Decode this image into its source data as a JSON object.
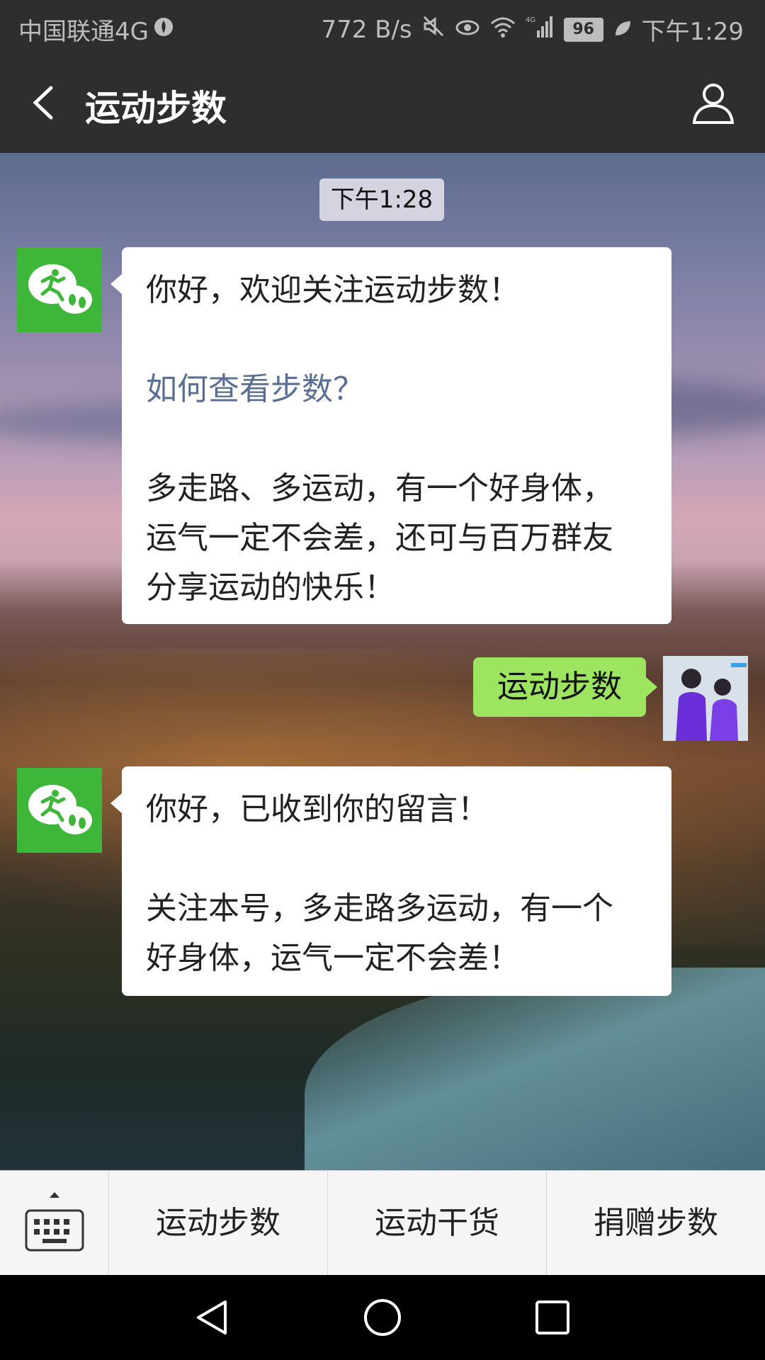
{
  "status_bar": {
    "carrier": "中国联通4G",
    "speed": "772 B/s",
    "battery": "96",
    "time": "下午1:29",
    "network": "4G"
  },
  "header": {
    "title": "运动步数"
  },
  "chat": {
    "timestamp": "下午1:28",
    "messages": [
      {
        "from": "bot",
        "lines": [
          "你好，欢迎关注运动步数！",
          "如何查看步数？",
          "多走路、多运动，有一个好身体，",
          "运气一定不会差，还可与百万群友",
          "分享运动的快乐！"
        ]
      },
      {
        "from": "me",
        "text": "运动步数"
      },
      {
        "from": "bot",
        "lines": [
          "你好，已收到你的留言！",
          "关注本号，多走路多运动，有一个",
          "好身体，运气一定不会差！"
        ]
      }
    ]
  },
  "menu": {
    "items": [
      "运动步数",
      "运动干货",
      "捐赠步数"
    ]
  },
  "colors": {
    "bar_bg": "#2e2e2e",
    "bot_avatar": "#3eb63a",
    "my_bubble": "#9de561",
    "link": "#5a6f93"
  }
}
